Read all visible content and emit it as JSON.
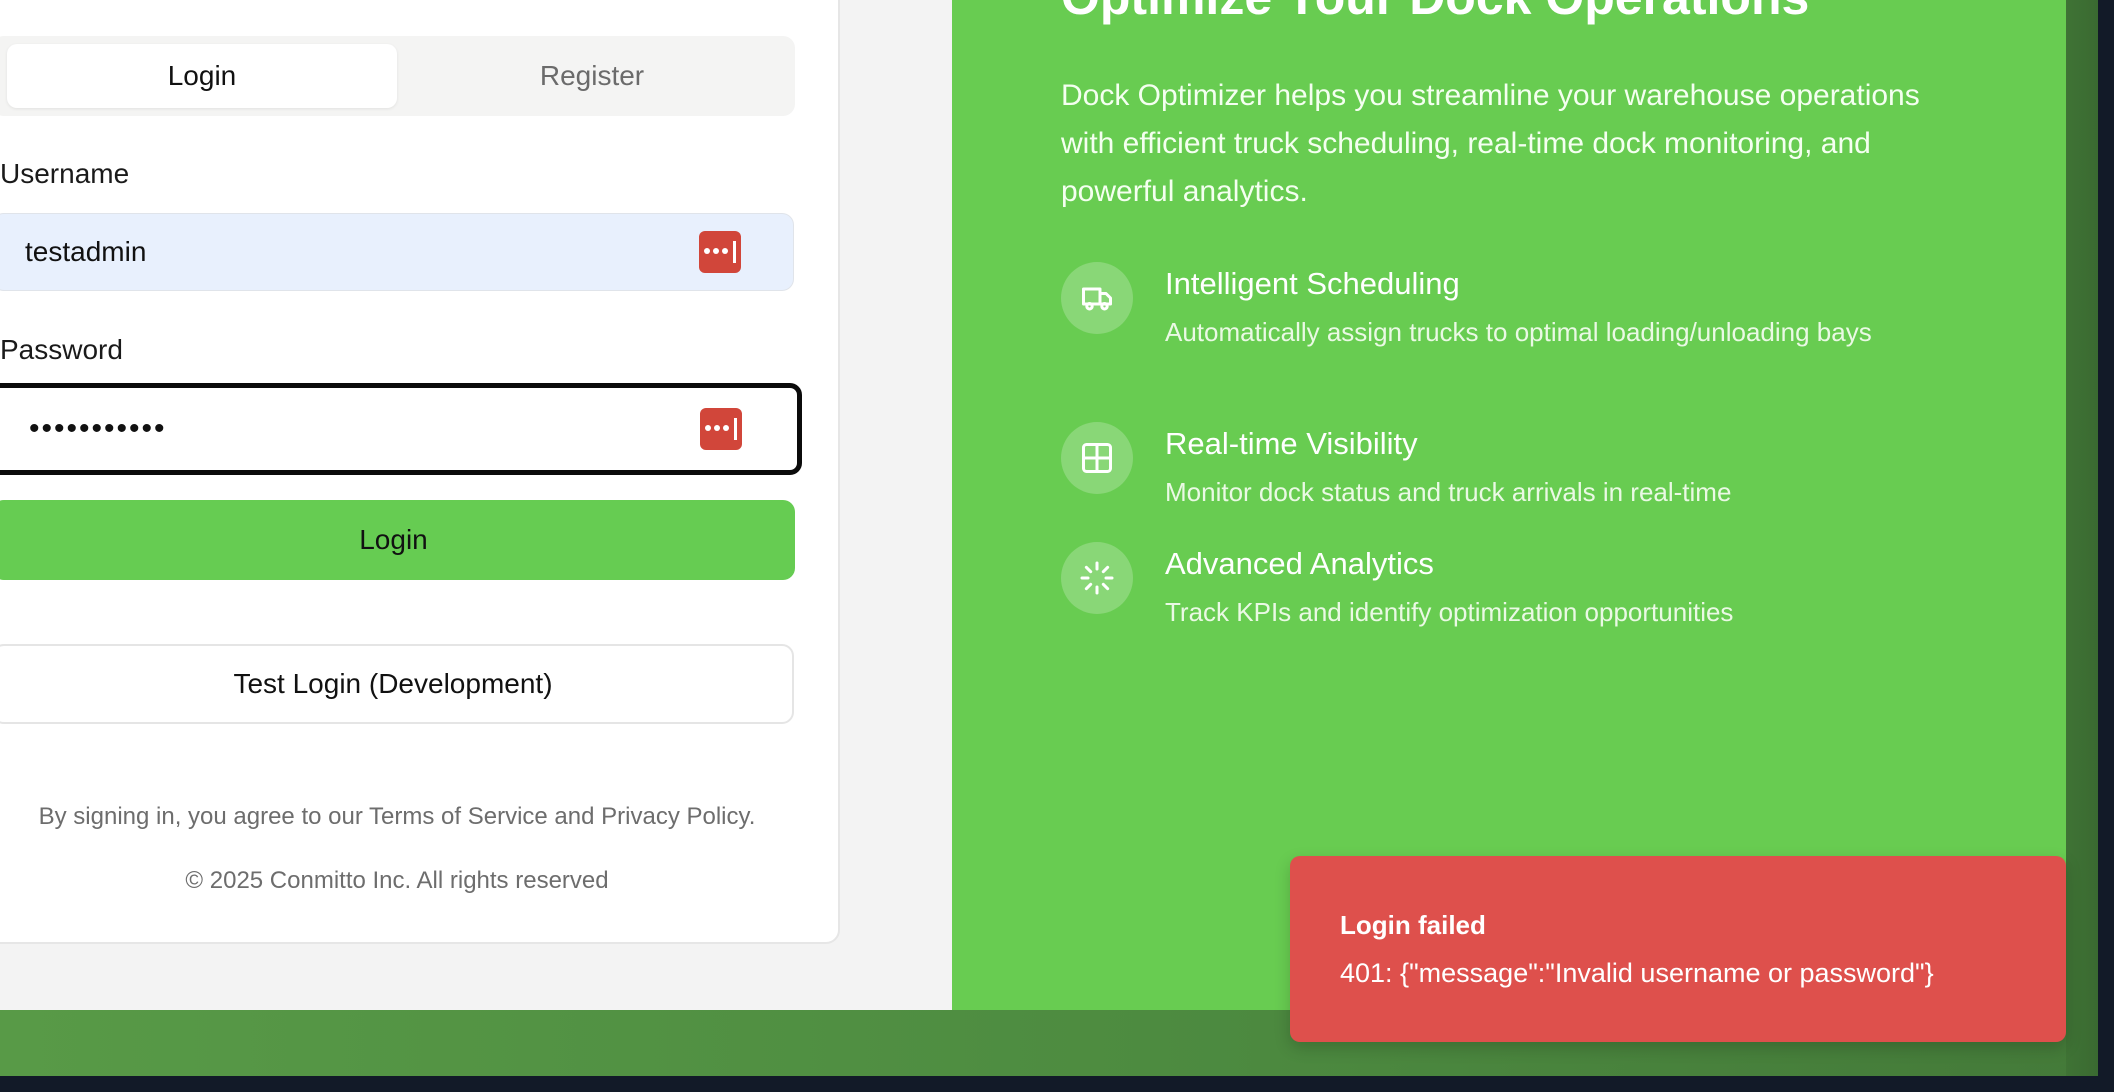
{
  "auth_tabs": {
    "login": "Login",
    "register": "Register"
  },
  "form": {
    "username_label": "Username",
    "username_value": "testadmin",
    "password_label": "Password",
    "password_value": "•••••••••••",
    "login_button": "Login",
    "test_login_button": "Test Login (Development)"
  },
  "footer": {
    "terms": "By signing in, you agree to our Terms of Service and Privacy Policy.",
    "copyright": "© 2025 Conmitto Inc. All rights reserved"
  },
  "hero": {
    "title": "Optimize Your Dock Operations",
    "description": "Dock Optimizer helps you streamline your warehouse operations with efficient truck scheduling, real-time dock monitoring, and powerful analytics.",
    "features": [
      {
        "icon": "truck-icon",
        "title": "Intelligent Scheduling",
        "description": "Automatically assign trucks to optimal loading/unloading bays"
      },
      {
        "icon": "layout-grid-icon",
        "title": "Real-time Visibility",
        "description": "Monitor dock status and truck arrivals in real-time"
      },
      {
        "icon": "loader-icon",
        "title": "Advanced Analytics",
        "description": "Track KPIs and identify optimization opportunities"
      }
    ]
  },
  "toast": {
    "title": "Login failed",
    "message": "401: {\"message\":\"Invalid username or password\"}"
  },
  "colors": {
    "brand_green": "#68cc51",
    "button_green": "#66cc52",
    "error_red": "#de504c",
    "password_manager_red": "#d1463a"
  }
}
